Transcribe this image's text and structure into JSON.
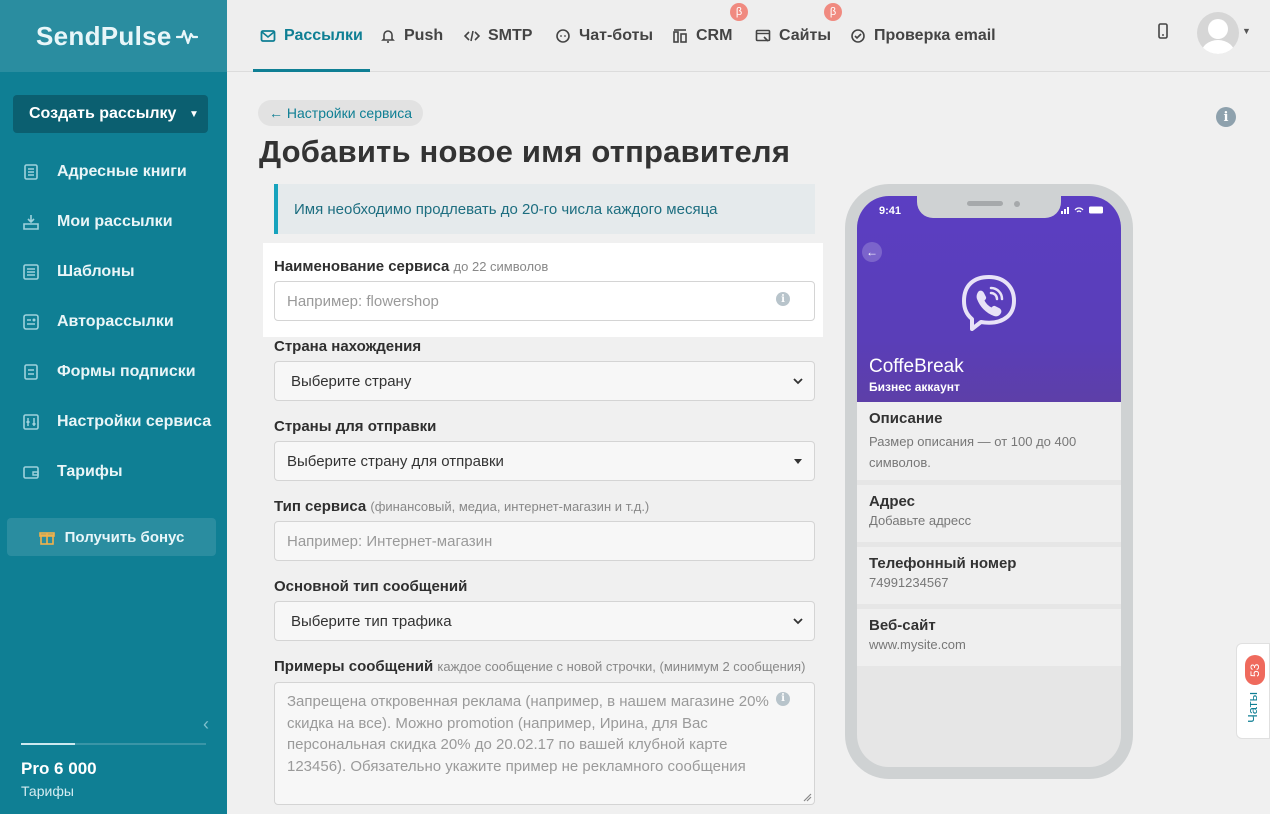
{
  "brand": {
    "name": "SendPulse"
  },
  "sidebar": {
    "create_button": "Создать рассылку",
    "items": [
      {
        "label": "Адресные книги",
        "icon": "address-book-icon"
      },
      {
        "label": "Мои рассылки",
        "icon": "campaigns-icon"
      },
      {
        "label": "Шаблоны",
        "icon": "templates-icon"
      },
      {
        "label": "Авторассылки",
        "icon": "automation-icon"
      },
      {
        "label": "Формы подписки",
        "icon": "forms-icon"
      },
      {
        "label": "Настройки сервиса",
        "icon": "settings-icon"
      },
      {
        "label": "Тарифы",
        "icon": "wallet-icon"
      }
    ],
    "bonus_button": "Получить бонус",
    "plan": {
      "name": "Pro 6 000",
      "link": "Тарифы",
      "usage_fraction": 0.29
    }
  },
  "topnav": {
    "tabs": [
      {
        "label": "Рассылки",
        "icon": "mail-icon",
        "active": true
      },
      {
        "label": "Push",
        "icon": "bell-icon"
      },
      {
        "label": "SMTP",
        "icon": "code-icon"
      },
      {
        "label": "Чат-боты",
        "icon": "chat-icon"
      },
      {
        "label": "CRM",
        "icon": "crm-icon",
        "beta": "β"
      },
      {
        "label": "Сайты",
        "icon": "sites-icon",
        "beta": "β"
      },
      {
        "label": "Проверка email",
        "icon": "check-icon"
      }
    ]
  },
  "main": {
    "back_link": "← Настройки сервиса",
    "title": "Добавить новое имя отправителя",
    "notice": "Имя необходимо продлевать до 20-го числа каждого месяца",
    "fields": {
      "service_name": {
        "label": "Наименование сервиса",
        "hint": "до 22 символов",
        "placeholder": "Например: flowershop"
      },
      "country": {
        "label": "Страна нахождения",
        "selected": "Выберите страну"
      },
      "send_countries": {
        "label": "Страны для отправки",
        "selected": "Выберите страну для отправки"
      },
      "service_type": {
        "label": "Тип сервиса",
        "hint": "(финансовый, медиа, интернет-магазин и т.д.)",
        "placeholder": "Например: Интернет-магазин"
      },
      "message_type": {
        "label": "Основной тип сообщений",
        "selected": "Выберите тип трафика"
      },
      "examples": {
        "label": "Примеры сообщений",
        "hint": "каждое сообщение с новой строчки, (минимум 2 сообщения)",
        "placeholder": "Запрещена откровенная реклама (например, в нашем магазине 20% скидка на все). Можно promotion (например, Ирина, для Вас персональная скидка 20% до 20.02.17 по вашей клубной карте 123456). Обязательно укажите пример не рекламного сообщения"
      }
    }
  },
  "phone": {
    "time": "9:41",
    "name": "CoffeBreak",
    "subtitle": "Бизнес аккаунт",
    "cards": [
      {
        "title": "Описание",
        "value": "Размер описания — от 100 до 400 символов."
      },
      {
        "title": "Адрес",
        "value": "Добавьте адресс"
      },
      {
        "title": "Телефонный номер",
        "value": "74991234567"
      },
      {
        "title": "Веб-сайт",
        "value": "www.mysite.com"
      }
    ]
  },
  "chats": {
    "label": "Чаты",
    "count": "53"
  },
  "colors": {
    "sidebar": "#0f7f94",
    "accent": "#0f7f94",
    "viber": "#5b3ec2"
  }
}
